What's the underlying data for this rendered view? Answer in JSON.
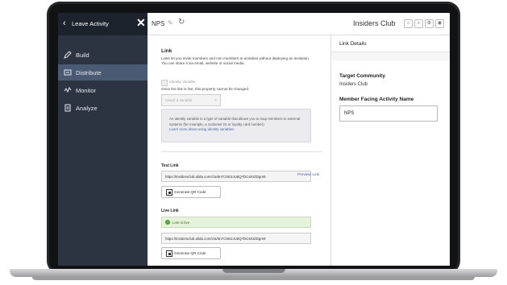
{
  "sidebar": {
    "back_glyph": "‹",
    "title": "Leave Activity",
    "close_glyph": "✕",
    "items": [
      {
        "label": "Build",
        "icon": "pencil-icon",
        "active": false
      },
      {
        "label": "Distribute",
        "icon": "share-icon",
        "active": true
      },
      {
        "label": "Monitor",
        "icon": "monitor-icon",
        "active": false
      },
      {
        "label": "Analyze",
        "icon": "clipboard-icon",
        "active": false
      }
    ]
  },
  "topbar": {
    "activity_name": "NPS",
    "edit_glyph": "✎",
    "refresh_glyph": "↻",
    "community": "Insiders Club"
  },
  "main": {
    "heading": "Link",
    "description": "Links let you invite members and non members to activities without deploying an invitation. You can share it via email, website or social media.",
    "identity_variable_label": "Identity Variable",
    "once_live_note": "Once the link is live, this property cannot be changed.",
    "select_placeholder": "Select a variable",
    "info_text": "An identity variable is a type of variable that allows you to map members to external systems (for example, a customer ID or loyalty card number).",
    "info_link": "Learn more about using identity variables",
    "test_link_heading": "Test Link",
    "test_link_url": "https://insidersclub.alida.com/c/a/6n7CSE2JU6Q7DC6XIZDgm9",
    "preview_link": "Preview Link",
    "generate_qr": "Generate QR Code",
    "live_link_heading": "Live Link",
    "live_status": "Link is live",
    "live_link_url": "https://insidersclub.alida.com/c/a/6n7CSE2JU6Q7DC6XIZDgm9"
  },
  "details": {
    "title": "Link Details",
    "target_label": "Target Community",
    "target_value": "Insiders Club",
    "facing_label": "Member Facing Activity Name",
    "facing_value": "NPS"
  },
  "colors": {
    "sidebar_bg": "#2c3441",
    "sidebar_active": "#4a5a72",
    "link_blue": "#3a6ab8",
    "live_green": "#4b9b2e"
  }
}
